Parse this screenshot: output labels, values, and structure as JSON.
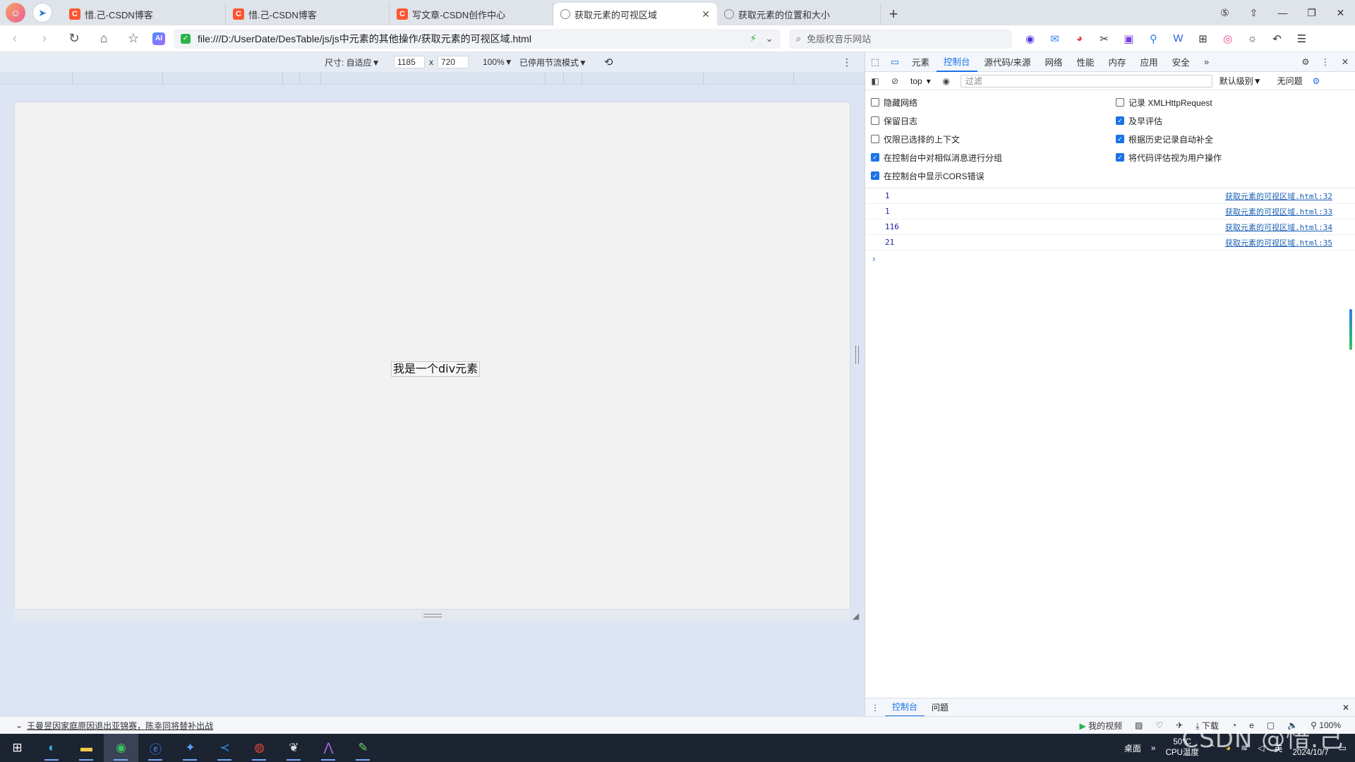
{
  "tabs": [
    {
      "title": "惜.己-CSDN博客",
      "icon": "csdn-icon"
    },
    {
      "title": "惜.己-CSDN博客",
      "icon": "csdn-icon"
    },
    {
      "title": "写文章-CSDN创作中心",
      "icon": "csdn-icon"
    },
    {
      "title": "获取元素的可视区域",
      "icon": "globe-icon"
    },
    {
      "title": "获取元素的位置和大小",
      "icon": "globe-icon"
    }
  ],
  "address": {
    "url": "file:///D:/UserDate/DesTable/js/js中元素的其他操作/获取元素的可视区域.html",
    "search_placeholder": "免版权音乐网站"
  },
  "device_toolbar": {
    "size_label": "尺寸: 自适应▼",
    "width": "1185",
    "times": "x",
    "height": "720",
    "zoom": "100%▼",
    "throttle": "已停用节流模式▼"
  },
  "page": {
    "div_text": "我是一个div元素"
  },
  "devtools": {
    "tabs": [
      "元素",
      "控制台",
      "源代码/来源",
      "网络",
      "性能",
      "内存",
      "应用",
      "安全"
    ],
    "active_tab": "控制台",
    "context": "top",
    "filter_placeholder": "过滤",
    "levels": "默认级别▼",
    "issues": "无问题",
    "settings_left": [
      {
        "label": "隐藏网络",
        "checked": false
      },
      {
        "label": "保留日志",
        "checked": false
      },
      {
        "label": "仅限已选择的上下文",
        "checked": false
      },
      {
        "label": "在控制台中对相似消息进行分组",
        "checked": true
      },
      {
        "label": "在控制台中显示CORS错误",
        "checked": true
      }
    ],
    "settings_right": [
      {
        "label": "记录 XMLHttpRequest",
        "checked": false
      },
      {
        "label": "及早评估",
        "checked": true
      },
      {
        "label": "根据历史记录自动补全",
        "checked": true
      },
      {
        "label": "将代码评估视为用户操作",
        "checked": true
      }
    ],
    "logs": [
      {
        "value": "1",
        "source": "获取元素的可视区域.html:32"
      },
      {
        "value": "1",
        "source": "获取元素的可视区域.html:33"
      },
      {
        "value": "116",
        "source": "获取元素的可视区域.html:34"
      },
      {
        "value": "21",
        "source": "获取元素的可视区域.html:35"
      }
    ],
    "prompt": "›",
    "drawer_tabs": [
      "控制台",
      "问题"
    ]
  },
  "statusbar": {
    "news": "王曼昱因家庭原因退出亚锦赛，陈幸同将替补出战",
    "video": "我的视频",
    "download": "下载",
    "zoom": "100%"
  },
  "taskbar": {
    "desktop": "桌面",
    "temp": "50°C",
    "temp_label": "CPU温度",
    "lang": "英",
    "date": "2024/10/7"
  },
  "watermark": "CSDN @惜.己",
  "colors": {
    "accent": "#1a73e8",
    "csdn": "#fc5531",
    "taskbar": "#1c2331"
  }
}
